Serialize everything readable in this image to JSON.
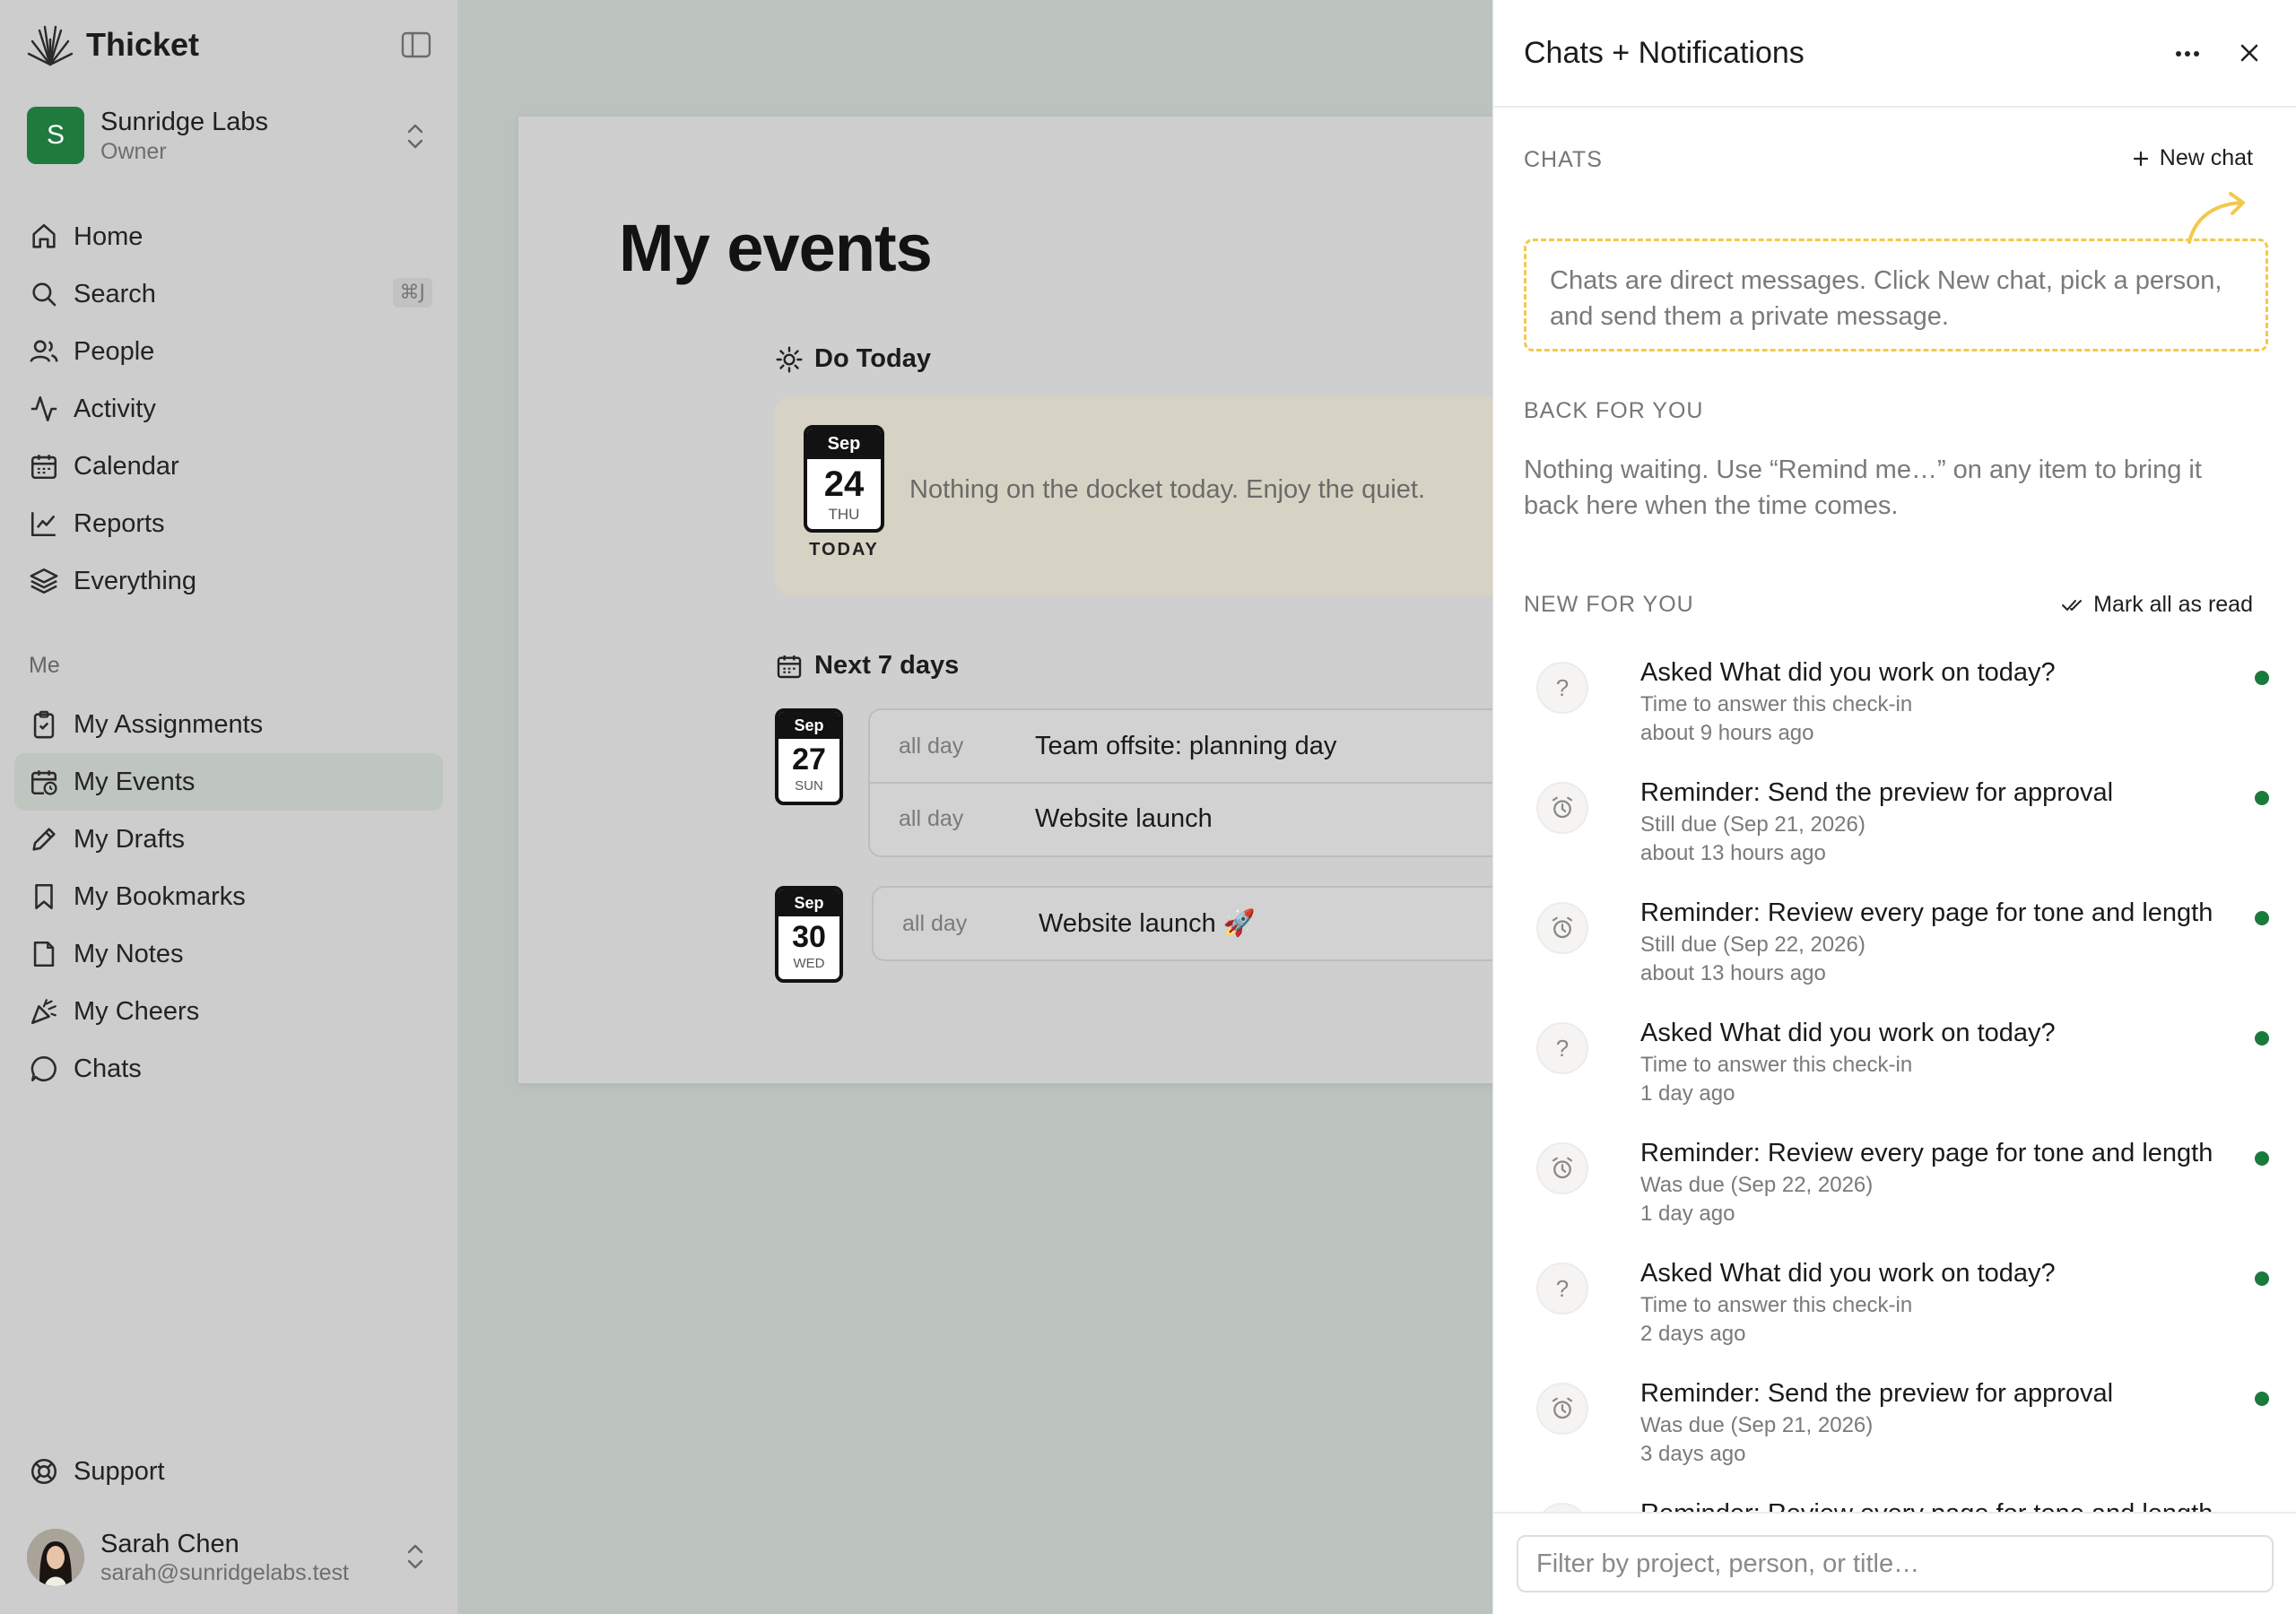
{
  "app": {
    "name": "Thicket"
  },
  "workspace": {
    "initial": "S",
    "name": "Sunridge Labs",
    "role": "Owner"
  },
  "nav": {
    "items": [
      {
        "label": "Home",
        "icon": "home-icon"
      },
      {
        "label": "Search",
        "icon": "search-icon",
        "shortcut": "⌘J"
      },
      {
        "label": "People",
        "icon": "people-icon"
      },
      {
        "label": "Activity",
        "icon": "activity-icon"
      },
      {
        "label": "Calendar",
        "icon": "calendar-icon"
      },
      {
        "label": "Reports",
        "icon": "reports-icon"
      },
      {
        "label": "Everything",
        "icon": "layers-icon"
      }
    ],
    "me_label": "Me",
    "me_items": [
      {
        "label": "My Assignments",
        "icon": "clipboard-icon"
      },
      {
        "label": "My Events",
        "icon": "calendar-clock-icon",
        "active": true
      },
      {
        "label": "My Drafts",
        "icon": "pencil-icon"
      },
      {
        "label": "My Bookmarks",
        "icon": "bookmark-icon"
      },
      {
        "label": "My Notes",
        "icon": "note-icon"
      },
      {
        "label": "My Cheers",
        "icon": "party-icon"
      },
      {
        "label": "Chats",
        "icon": "chat-icon"
      }
    ],
    "support_label": "Support"
  },
  "user": {
    "name": "Sarah Chen",
    "email": "sarah@sunridgelabs.test"
  },
  "page": {
    "title": "My events",
    "do_today": {
      "heading": "Do Today",
      "month": "Sep",
      "day": "24",
      "dow": "THU",
      "today_label": "TODAY",
      "message": "Nothing on the docket today. Enjoy the quiet."
    },
    "next7": {
      "heading": "Next 7 days",
      "groups": [
        {
          "month": "Sep",
          "day": "27",
          "dow": "SUN",
          "events": [
            {
              "time": "all day",
              "title": "Team offsite: planning day"
            },
            {
              "time": "all day",
              "title": "Website launch"
            }
          ]
        },
        {
          "month": "Sep",
          "day": "30",
          "dow": "WED",
          "events": [
            {
              "time": "all day",
              "title": "Website launch 🚀"
            }
          ]
        }
      ]
    }
  },
  "panel": {
    "title": "Chats + Notifications",
    "chats_label": "CHATS",
    "new_chat": "New chat",
    "chats_hint": "Chats are direct messages. Click New chat, pick a person, and send them a private message.",
    "back_label": "BACK FOR YOU",
    "back_text": "Nothing waiting. Use “Remind me…” on any item to bring it back here when the time comes.",
    "new_label": "NEW FOR YOU",
    "mark_all": "Mark all as read",
    "notifications": [
      {
        "kind": "question",
        "title": "Asked What did you work on today?",
        "sub": "Time to answer this check-in",
        "time": "about 9 hours ago"
      },
      {
        "kind": "reminder",
        "title": "Reminder: Send the preview for approval",
        "sub": "Still due (Sep 21, 2026)",
        "time": "about 13 hours ago"
      },
      {
        "kind": "reminder",
        "title": "Reminder: Review every page for tone and length",
        "sub": "Still due (Sep 22, 2026)",
        "time": "about 13 hours ago"
      },
      {
        "kind": "question",
        "title": "Asked What did you work on today?",
        "sub": "Time to answer this check-in",
        "time": "1 day ago"
      },
      {
        "kind": "reminder",
        "title": "Reminder: Review every page for tone and length",
        "sub": "Was due (Sep 22, 2026)",
        "time": "1 day ago"
      },
      {
        "kind": "question",
        "title": "Asked What did you work on today?",
        "sub": "Time to answer this check-in",
        "time": "2 days ago"
      },
      {
        "kind": "reminder",
        "title": "Reminder: Send the preview for approval",
        "sub": "Was due (Sep 21, 2026)",
        "time": "3 days ago"
      },
      {
        "kind": "reminder",
        "title": "Reminder: Review every page for tone and length",
        "sub": "",
        "time": ""
      }
    ],
    "filter_placeholder": "Filter by project, person, or title…"
  },
  "colors": {
    "brand_green": "#1f7a3e",
    "unread_dot": "#1a7a3d",
    "hint_border": "#f2c94c"
  }
}
